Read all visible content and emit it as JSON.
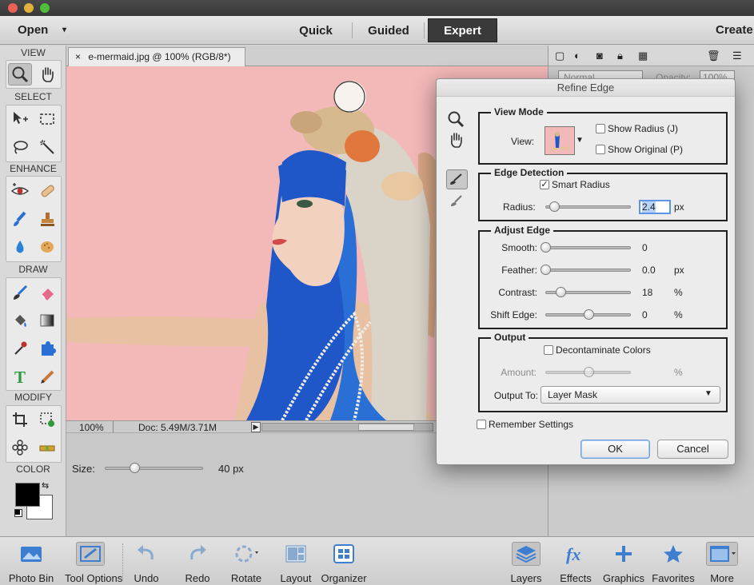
{
  "menubar": {
    "open_label": "Open",
    "modes": [
      "Quick",
      "Guided",
      "Expert"
    ],
    "active_mode": "Expert",
    "create_label": "Create"
  },
  "toolpanel": {
    "sections": [
      "VIEW",
      "SELECT",
      "ENHANCE",
      "DRAW",
      "MODIFY",
      "COLOR"
    ]
  },
  "document": {
    "tab_close": "×",
    "tab_title": "e-mermaid.jpg @ 100% (RGB/8*)",
    "zoom": "100%",
    "doc_size": "Doc: 5.49M/3.71M"
  },
  "tool_options": {
    "size_label": "Size:",
    "size_value": "40 px",
    "size_level": 0.3
  },
  "rightpanel": {
    "blend_mode": "Normal",
    "opacity_label": "Opacity:",
    "opacity_value": "100%"
  },
  "dialog": {
    "title": "Refine Edge",
    "view_mode": {
      "title": "View Mode",
      "view_label": "View:",
      "show_radius_label": "Show Radius (J)",
      "show_radius_checked": false,
      "show_original_label": "Show Original (P)",
      "show_original_checked": false
    },
    "edge_detection": {
      "title": "Edge Detection",
      "smart_radius_label": "Smart Radius",
      "smart_radius_checked": true,
      "radius_label": "Radius:",
      "radius_value": "2.4",
      "radius_unit": "px",
      "radius_level": 0.1
    },
    "adjust_edge": {
      "title": "Adjust Edge",
      "rows": [
        {
          "label": "Smooth:",
          "value": "0",
          "unit": "",
          "level": 0.0
        },
        {
          "label": "Feather:",
          "value": "0.0",
          "unit": "px",
          "level": 0.0
        },
        {
          "label": "Contrast:",
          "value": "18",
          "unit": "%",
          "level": 0.18
        },
        {
          "label": "Shift Edge:",
          "value": "0",
          "unit": "%",
          "level": 0.5
        }
      ]
    },
    "output": {
      "title": "Output",
      "decontaminate_label": "Decontaminate Colors",
      "decontaminate_checked": false,
      "amount_label": "Amount:",
      "amount_unit": "%",
      "amount_level": 0.5,
      "output_to_label": "Output To:",
      "output_to_value": "Layer Mask"
    },
    "remember_label": "Remember Settings",
    "remember_checked": false,
    "ok_label": "OK",
    "cancel_label": "Cancel"
  },
  "bottombar": {
    "items": [
      "Photo Bin",
      "Tool Options",
      "Undo",
      "Redo",
      "Rotate",
      "Layout",
      "Organizer",
      "Layers",
      "Effects",
      "Graphics",
      "Favorites",
      "More"
    ]
  },
  "colors": {
    "canvas_bg": "#f3b8b8",
    "accent_blue": "#2a6fd6",
    "hair_blue": "#1f57c9",
    "close_red": "#ec5f57",
    "minimize_yellow": "#e2b23a",
    "zoom_green": "#4fbf3b"
  }
}
